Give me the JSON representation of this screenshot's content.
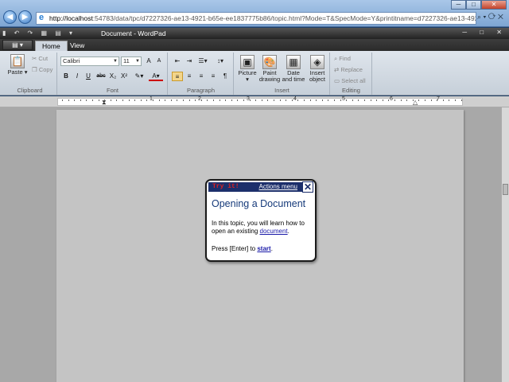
{
  "browser": {
    "address_host": "http://localhost",
    "address_rest": ":54783/data/tpc/d7227326-ae13-4921-b65e-ee1837775b86/topic.html?Mode=T&SpecMode=Y&printitname=d7227326-ae13-4921-b65e-ee1837775",
    "search_glyph": "⌕ ▾ ⟳ ✕",
    "min": "─",
    "max": "□",
    "close": "✕"
  },
  "wordpad": {
    "title": "Document - WordPad",
    "qat_glyphs": "▮ ↶ ↷ ▦ ▤ ▾",
    "win_glyphs": "─ □ ✕",
    "app_menu": "▤ ▾",
    "tabs": [
      {
        "label": "Home"
      },
      {
        "label": "View"
      }
    ]
  },
  "ribbon": {
    "clipboard": {
      "label": "Clipboard",
      "paste": "Paste",
      "cut": "Cut",
      "copy": "Copy"
    },
    "font": {
      "label": "Font",
      "family": "Calibri",
      "size": "11",
      "grow": "A",
      "shrink": "A",
      "bold": "B",
      "italic": "I",
      "underline": "U",
      "strike": "abc",
      "sub": "X₂",
      "sup": "X²",
      "color": "A"
    },
    "paragraph": {
      "label": "Paragraph"
    },
    "insert": {
      "label": "Insert",
      "picture": "Picture",
      "paint": "Paint drawing",
      "datetime": "Date and time",
      "object": "Insert object"
    },
    "editing": {
      "label": "Editing",
      "find": "Find",
      "replace": "Replace",
      "select_all": "Select all"
    }
  },
  "ruler": {
    "numbers": [
      "1",
      "2",
      "3",
      "4",
      "5",
      "6",
      "7"
    ]
  },
  "dialog": {
    "try_it": "Try it!",
    "actions_menu": "Actions menu",
    "close": "✕",
    "title": "Opening a Document",
    "body_prefix": "In this topic, you will learn how to open an existing ",
    "body_link": "document",
    "body_suffix": ".",
    "press_prefix": "Press [Enter] to ",
    "press_link": "start",
    "press_suffix": "."
  }
}
